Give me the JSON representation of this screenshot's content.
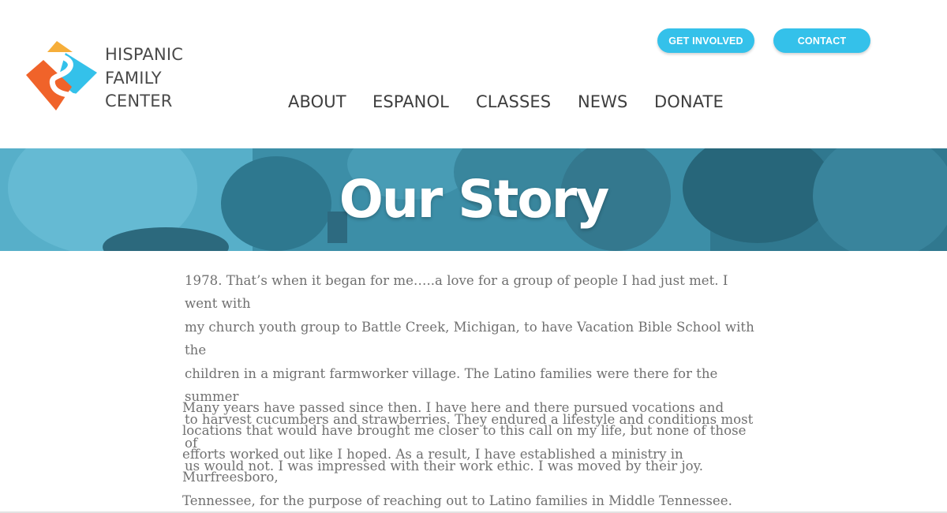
{
  "brand": {
    "name_lines": [
      "HISPANIC",
      "FAMILY",
      "CENTER"
    ],
    "logo": "hispanic-family-center-logo",
    "colors": {
      "orange": "#f0632a",
      "yellow": "#f6ae3a",
      "blue": "#34c1ea"
    }
  },
  "header": {
    "buttons": {
      "get_involved": "GET INVOLVED",
      "contact": "CONTACT"
    },
    "nav": [
      "ABOUT",
      "ESPANOL",
      "CLASSES",
      "NEWS",
      "DONATE"
    ]
  },
  "hero": {
    "title": "Our Story",
    "overlay_color": "#3aa0bf"
  },
  "content": {
    "paragraphs": [
      [
        "1978. That’s when it began for me…..a love for a group of people I had just met. I went with",
        "my church youth group to Battle Creek, Michigan, to have Vacation Bible School with the",
        "children in a migrant farmworker village. The Latino families were there for the summer",
        "to harvest cucumbers and strawberries. They endured a lifestyle and conditions most of",
        "us would not. I was impressed with their work ethic. I was moved by their joy."
      ],
      [
        "Many years have passed since then. I have here and there pursued vocations and",
        "locations that would have brought me closer to this call on my life, but none of those",
        "efforts worked out like I hoped. As a result, I have established a ministry in Murfreesboro,",
        "Tennessee, for the purpose of reaching out to Latino families in Middle Tennessee."
      ]
    ]
  }
}
